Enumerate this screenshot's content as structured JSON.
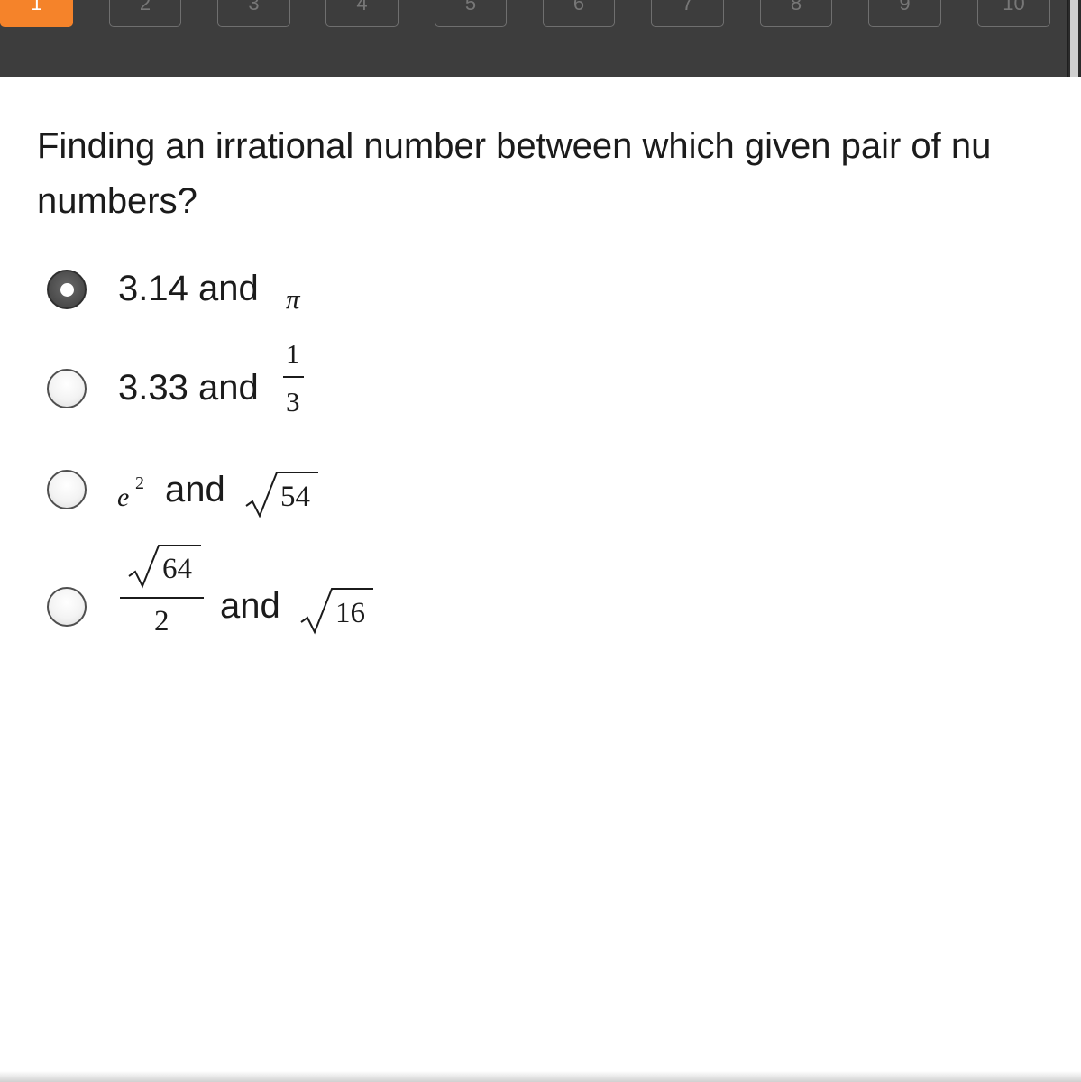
{
  "nav": {
    "questions": [
      {
        "label": "1",
        "active": true
      },
      {
        "label": "2"
      },
      {
        "label": "3"
      },
      {
        "label": "4"
      },
      {
        "label": "5"
      },
      {
        "label": "6"
      },
      {
        "label": "7"
      },
      {
        "label": "8"
      },
      {
        "label": "9"
      },
      {
        "label": "10"
      }
    ]
  },
  "question": {
    "line1": "Finding an irrational number between which given pair of nu",
    "line2": "numbers?"
  },
  "options": [
    {
      "selected": true,
      "text": "3.14 and",
      "math": {
        "pi": "π"
      }
    },
    {
      "selected": false,
      "text": "3.33 and",
      "math": {
        "numerator": "1",
        "denominator": "3"
      }
    },
    {
      "selected": false,
      "text": "and",
      "math": {
        "base": "e",
        "exponent": "2",
        "radicand": "54"
      }
    },
    {
      "selected": false,
      "text": "and",
      "math": {
        "num_radicand": "64",
        "denominator": "2",
        "radicand": "16"
      }
    }
  ],
  "colors": {
    "topbar": "#3d3d3d",
    "active_tab": "#f5832a",
    "text": "#1b1b1b"
  }
}
